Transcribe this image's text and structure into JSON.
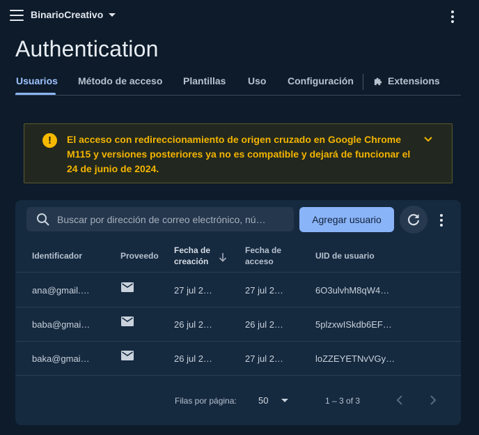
{
  "topbar": {
    "project_name": "BinarioCreativo"
  },
  "page": {
    "title": "Authentication"
  },
  "tabs": [
    {
      "label": "Usuarios",
      "active": true
    },
    {
      "label": "Método de acceso"
    },
    {
      "label": "Plantillas"
    },
    {
      "label": "Uso"
    },
    {
      "label": "Configuración"
    },
    {
      "label": "Extensions"
    }
  ],
  "banner": {
    "text": "El acceso con redireccionamiento de origen cruzado en Google Chrome M115 y versiones posteriores ya no es compatible y dejará de funcionar el 24 de junio de 2024.",
    "accent_color": "#f4b400"
  },
  "toolbar": {
    "search_placeholder": "Buscar por dirección de correo electrónico, nú…",
    "add_user_label": "Agregar usuario"
  },
  "table": {
    "headers": {
      "identifier": "Identificador",
      "provider": "Proveedo",
      "created_line1": "Fecha de",
      "created_line2": "creación",
      "access_line1": "Fecha de",
      "access_line2": "acceso",
      "uid": "UID de usuario"
    },
    "rows": [
      {
        "identifier": "ana@gmail.…",
        "provider_icon": "mail-icon",
        "created": "27 jul 2…",
        "access": "27 jul 2…",
        "uid": "6O3ulvhM8qW4…"
      },
      {
        "identifier": "baba@gmai…",
        "provider_icon": "mail-icon",
        "created": "26 jul 2…",
        "access": "26 jul 2…",
        "uid": "5plzxwISkdb6EF…"
      },
      {
        "identifier": "baka@gmai…",
        "provider_icon": "mail-icon",
        "created": "26 jul 2…",
        "access": "27 jul 2…",
        "uid": "loZZEYETNvVGy…"
      }
    ]
  },
  "pagination": {
    "rows_per_page_label": "Filas por página:",
    "rows_per_page": "50",
    "range": "1 – 3 of 3"
  },
  "colors": {
    "background": "#0d1b2a",
    "card": "#15293f",
    "primary": "#8ab4f8",
    "warning": "#f6b900"
  }
}
